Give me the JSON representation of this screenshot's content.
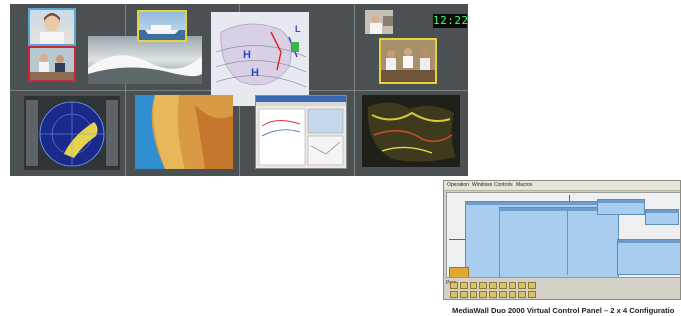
{
  "wall": {
    "clock": "12:22",
    "map_markers": [
      "H",
      "H",
      "L"
    ]
  },
  "panel": {
    "menu": [
      "Operation",
      "Windows",
      "Controls",
      "Macros"
    ],
    "status_label": "Pres"
  },
  "caption": "MediaWall Duo 2000 Virtual Control Panel – 2 x 4 Configuratio",
  "colors": {
    "wall_bg": "#4b5052",
    "panel_window": "#a9cdee",
    "clock_digits": "#47ff5a"
  }
}
